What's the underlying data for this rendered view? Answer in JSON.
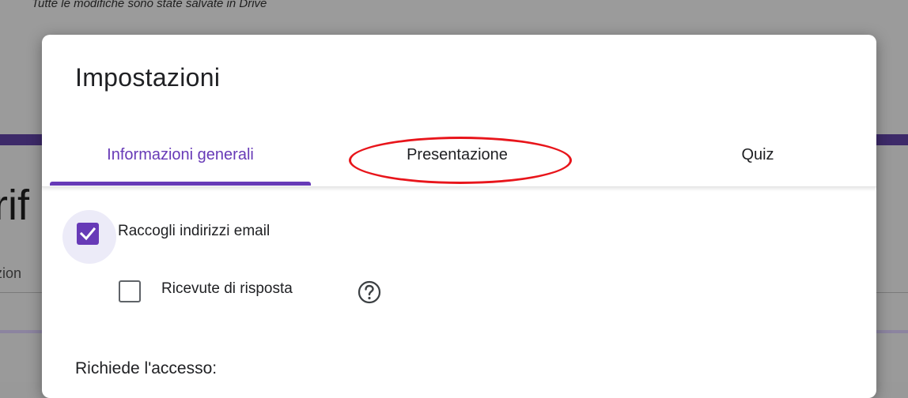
{
  "background": {
    "save_status": "Tutte le modifiche sono state salvate in Drive",
    "form_title_fragment": "rif",
    "form_desc_fragment": "zion"
  },
  "dialog": {
    "title": "Impostazioni",
    "tabs": [
      {
        "label": "Informazioni generali",
        "selected": true
      },
      {
        "label": "Presentazione",
        "selected": false,
        "highlighted": true
      },
      {
        "label": "Quiz",
        "selected": false
      }
    ],
    "options": {
      "collect_emails": {
        "label": "Raccogli indirizzi email",
        "checked": true
      },
      "response_receipts": {
        "label": "Ricevute di risposta",
        "checked": false,
        "icon": "help-icon"
      }
    },
    "section_access": "Richiede l'accesso:"
  },
  "colors": {
    "accent": "#673ab7",
    "annotation": "#e8151b"
  }
}
